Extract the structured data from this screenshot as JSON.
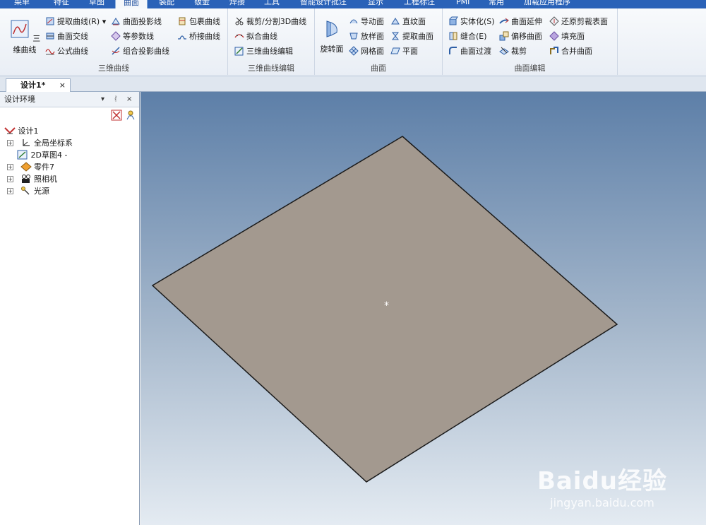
{
  "menu": {
    "tabs": [
      "菜单",
      "特征",
      "草图",
      "曲面",
      "装配",
      "钣金",
      "焊接",
      "工具",
      "智能设计批注",
      "显示",
      "工程标注",
      "PMI",
      "常用",
      "加载应用程序"
    ],
    "active_tab": "曲面"
  },
  "ribbon": {
    "groups": [
      {
        "label": "三维曲线",
        "big_button": "三维曲线",
        "items": [
          "提取曲线(R)",
          "曲面交线",
          "公式曲线",
          "曲面投影线",
          "等参数线",
          "组合投影曲线",
          "包裹曲线",
          "桥接曲线"
        ]
      },
      {
        "label": "三维曲线编辑",
        "items": [
          "裁剪/分割3D曲线",
          "拟合曲线",
          "三维曲线编辑"
        ]
      },
      {
        "label": "曲面",
        "big_button": "旋转面",
        "items": [
          "导动面",
          "放样面",
          "网格面",
          "直纹面",
          "提取曲面",
          "平面"
        ]
      },
      {
        "label": "曲面编辑",
        "items": [
          "实体化(S)",
          "缝合(E)",
          "曲面过渡",
          "曲面延伸",
          "偏移曲面",
          "裁剪",
          "还原剪裁表面",
          "填充面",
          "合并曲面"
        ]
      }
    ]
  },
  "document": {
    "tab_title": "设计1*",
    "close_symbol": "×"
  },
  "panel": {
    "title": "设计环境",
    "controls": [
      "▾",
      "ᚰ",
      "×"
    ],
    "tree": [
      {
        "label": "设计1",
        "icon": "design-root-icon",
        "expandable": false,
        "indent": 0
      },
      {
        "label": "全局坐标系",
        "icon": "coordinate-system-icon",
        "expandable": true,
        "indent": 1
      },
      {
        "label": "2D草图4 -",
        "icon": "sketch-icon",
        "expandable": false,
        "indent": 1
      },
      {
        "label": "零件7",
        "icon": "part-icon",
        "expandable": true,
        "indent": 1
      },
      {
        "label": "照相机",
        "icon": "camera-icon",
        "expandable": true,
        "indent": 1
      },
      {
        "label": "光源",
        "icon": "light-icon",
        "expandable": true,
        "indent": 1
      }
    ]
  },
  "viewport": {
    "surface_color": "#a3998f",
    "edge_color": "#1a1a1a",
    "center_marker": "*"
  },
  "watermark": {
    "brand": "Baidu经验",
    "url": "jingyan.baidu.com"
  },
  "colors": {
    "menu_bar": "#2a62b8",
    "accent": "#1f4f9e"
  }
}
